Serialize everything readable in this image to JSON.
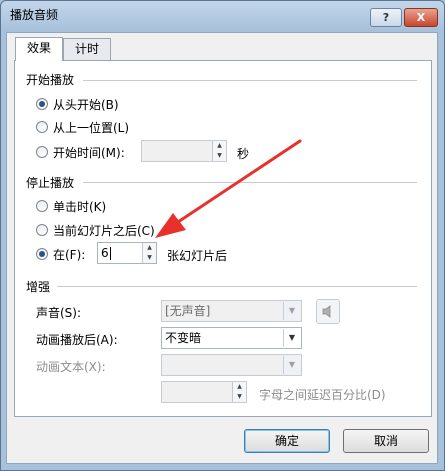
{
  "window": {
    "title": "播放音频",
    "help_button": "?",
    "close_button": "X"
  },
  "tabs": [
    {
      "label": "效果"
    },
    {
      "label": "计时"
    }
  ],
  "start_group": {
    "heading": "开始播放",
    "from_beginning": "从头开始(B)",
    "from_last_position": "从上一位置(L)",
    "start_time": "开始时间(M):",
    "seconds_unit": "秒"
  },
  "stop_group": {
    "heading": "停止播放",
    "on_click": "单击时(K)",
    "after_current_slide": "当前幻灯片之后(C)",
    "after": "在(F):",
    "after_value": "6",
    "slides_unit": "张幻灯片后"
  },
  "enhance_group": {
    "heading": "增强",
    "sound_label": "声音(S):",
    "sound_value": "[无声音]",
    "after_animation_label": "动画播放后(A):",
    "after_animation_value": "不变暗",
    "animate_text_label": "动画文本(X):",
    "animate_text_value": "",
    "delay_unit": "字母之间延迟百分比(D)"
  },
  "footer": {
    "ok": "确定",
    "cancel": "取消"
  }
}
